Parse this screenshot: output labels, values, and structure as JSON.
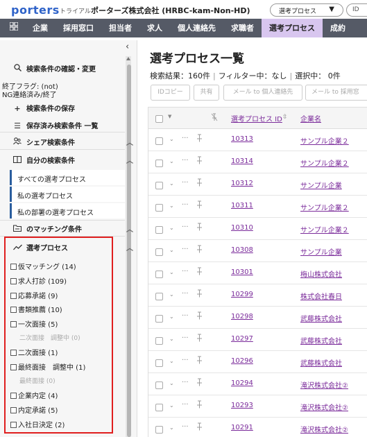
{
  "header": {
    "logo": "porters",
    "trial": "トライアル",
    "company": "ポーターズ株式会社 (HRBC-kam-Non-HD)",
    "select_value": "選考プロセス",
    "search_prefix": "ID"
  },
  "nav": {
    "items": [
      {
        "label": "企業"
      },
      {
        "label": "採用窓口"
      },
      {
        "label": "担当者"
      },
      {
        "label": "求人"
      },
      {
        "label": "個人連絡先"
      },
      {
        "label": "求職者"
      },
      {
        "label": "選考プロセス"
      },
      {
        "label": "成約"
      }
    ],
    "active_index": 6
  },
  "sidebar": {
    "collapse_glyph": "‹",
    "check_conditions": "検索条件の確認・変更",
    "end_flag_line1": "終了フラグ: (not)",
    "end_flag_line2": "NG連絡済み/終了",
    "save_conditions": "検索条件の保存",
    "saved_list": "保存済み検索条件 一覧",
    "share_conditions": "シェア検索条件",
    "my_conditions": "自分の検索条件",
    "saved_items": [
      {
        "label": "すべての選考プロセス"
      },
      {
        "label": "私の選考プロセス"
      },
      {
        "label": "私の部署の選考プロセス"
      }
    ],
    "matching": "のマッチング条件",
    "process_section": "選考プロセス",
    "phases": [
      {
        "label": "仮マッチング (14)"
      },
      {
        "label": "求人打診 (109)"
      },
      {
        "label": "応募承諾 (9)"
      },
      {
        "label": "書類推薦 (10)"
      },
      {
        "label": "一次面接 (5)"
      },
      {
        "label": "二次面接 (1)"
      },
      {
        "label": "最終面接　調整中 (1)"
      },
      {
        "label": "企業内定 (4)"
      },
      {
        "label": "内定承諾 (5)"
      },
      {
        "label": "入社日決定 (2)"
      }
    ],
    "sub_phases": [
      {
        "label": "二次面接　調整中 (0)"
      },
      {
        "label": "最終面接 (0)"
      }
    ]
  },
  "main": {
    "title": "選考プロセス一覧",
    "results": "検索結果：160件",
    "filter": "フィルター中：なし",
    "selected": "選択中： 0件",
    "buttons": [
      {
        "label": "IDコピー"
      },
      {
        "label": "共有"
      },
      {
        "label": "メール to 個人連絡先"
      },
      {
        "label": "メール to 採用窓"
      }
    ],
    "columns": {
      "process_id": "選考プロセス ID",
      "company": "企業名"
    },
    "rows": [
      {
        "id": "10313",
        "company": "サンプル企業２"
      },
      {
        "id": "10314",
        "company": "サンプル企業２"
      },
      {
        "id": "10312",
        "company": "サンプル企業"
      },
      {
        "id": "10311",
        "company": "サンプル企業２"
      },
      {
        "id": "10310",
        "company": "サンプル企業２"
      },
      {
        "id": "10308",
        "company": "サンプル企業"
      },
      {
        "id": "10301",
        "company": "梅山株式会社"
      },
      {
        "id": "10299",
        "company": "株式会社春日"
      },
      {
        "id": "10298",
        "company": "武藤株式会社"
      },
      {
        "id": "10297",
        "company": "武藤株式会社"
      },
      {
        "id": "10296",
        "company": "武藤株式会社"
      },
      {
        "id": "10294",
        "company": "滝沢株式会社②"
      },
      {
        "id": "10293",
        "company": "滝沢株式会社②"
      },
      {
        "id": "10291",
        "company": "滝沢株式会社②"
      }
    ]
  },
  "colors": {
    "nav_bg": "#555a66",
    "nav_active": "#d8c6ef",
    "highlight_box": "#e01e1e",
    "link": "#7a2a9a",
    "logo": "#2f63c9"
  },
  "icons": {
    "search": "magnifier-icon",
    "plus": "plus-icon",
    "list": "list-icon",
    "share": "people-icon",
    "book": "book-icon",
    "folder": "folder-icon",
    "trend": "trend-line-icon"
  }
}
